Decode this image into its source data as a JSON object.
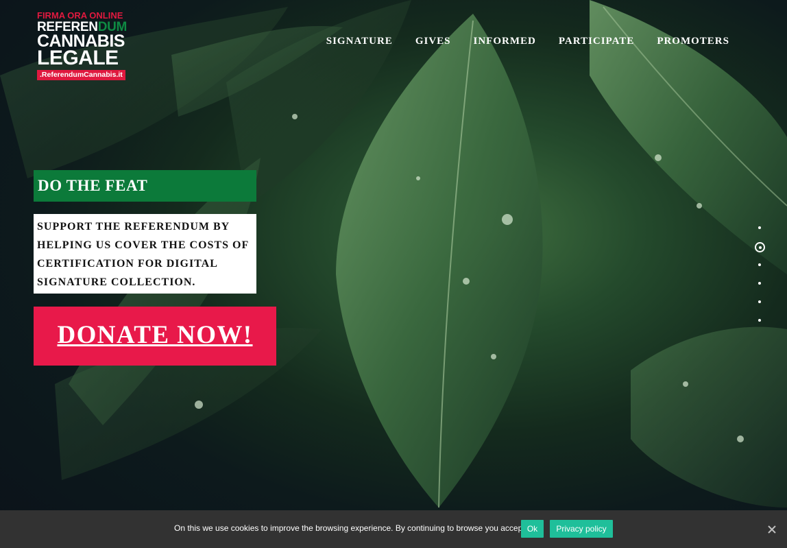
{
  "logo": {
    "line1": "FIRMA ORA ONLINE",
    "line2_a": "REFEREN",
    "line2_b": "DUM",
    "line3": "CANNABIS",
    "line4": "LEGALE",
    "url": ".ReferendumCannabis.it"
  },
  "nav": {
    "items": [
      "SIGNATURE",
      "GIVES",
      "INFORMED",
      "PARTICIPATE",
      "PROMOTERS"
    ]
  },
  "hero": {
    "heading": "DO THE FEAT",
    "description": "SUPPORT THE REFERENDUM BY HELPING US COVER THE COSTS OF CERTIFICATION FOR DIGITAL SIGNATURE COLLECTION.",
    "cta": "DONATE NOW!"
  },
  "slider": {
    "count": 6,
    "active_index": 1
  },
  "cookie_bar": {
    "text": "On this we use cookies to improve the browsing experience. By continuing to browse you accept",
    "ok_label": "Ok",
    "policy_label": "Privacy policy"
  },
  "colors": {
    "brand_red": "#e8194a",
    "brand_green": "#0c7a3a",
    "cookie_button": "#1fbf9a",
    "cookie_bg": "#323232"
  },
  "icons": {
    "close": "close-icon",
    "logo_leaf": "cannabis-leaf-icon"
  }
}
